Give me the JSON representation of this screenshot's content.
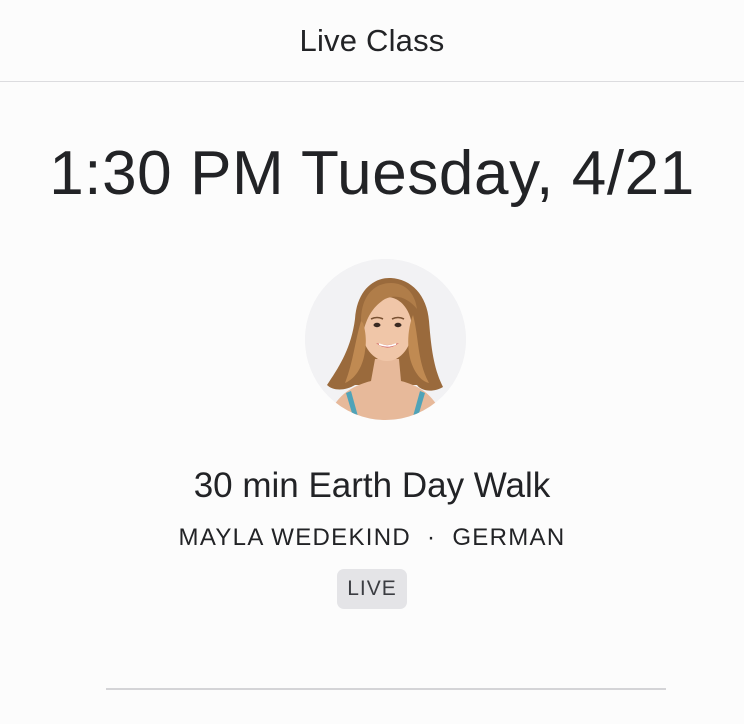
{
  "header": {
    "title": "Live Class"
  },
  "schedule": {
    "datetime": "1:30 PM Tuesday, 4/21"
  },
  "instructor": {
    "avatar_icon": "instructor-portrait",
    "name": "MAYLA WEDEKIND",
    "separator": "·",
    "language": "GERMAN"
  },
  "class": {
    "title": "30 min Earth Day Walk",
    "badge": "LIVE"
  },
  "colors": {
    "text": "#222326",
    "badge_bg": "#e4e4e7",
    "divider": "#d4d4d7",
    "background": "#fcfcfc"
  }
}
